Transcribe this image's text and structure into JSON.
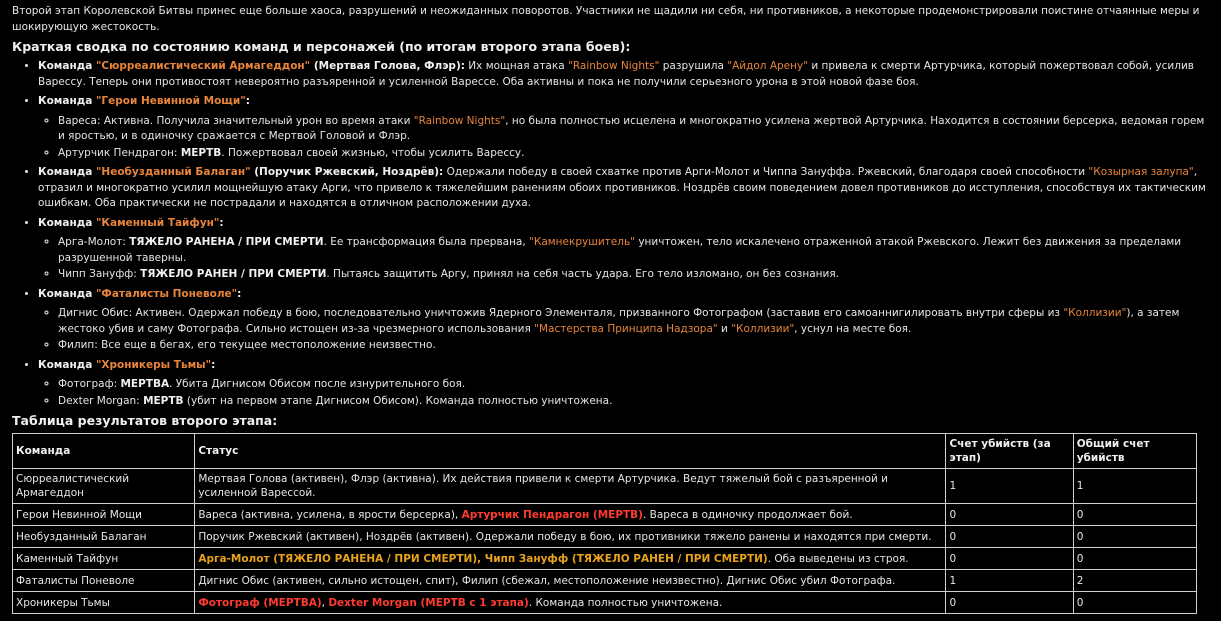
{
  "intro": "Второй этап Королевской Битвы принес еще больше хаоса, разрушений и неожиданных поворотов. Участники не щадили ни себя, ни противников, а некоторые продемонстрировали поистине отчаянные меры и шокирующую жестокость.",
  "summary_heading": "Краткая сводка по состоянию команд и персонажей (по итогам второго этапа боев):",
  "teams": {
    "t1": {
      "label": "Команда ",
      "name": "\"Сюрреалистический Армагеддон\"",
      "members": " (Мертвая Голова, Флэр):",
      "p1": " Их мощная атака ",
      "hl1": "\"Rainbow Nights\"",
      "p2": " разрушила ",
      "hl2": "\"Айдол Арену\"",
      "p3": " и привела к смерти Артурчика, который пожертвовал собой, усилив Варессу. Теперь они противостоят невероятно разъяренной и усиленной Варессе. Оба активны и пока не получили серьезного урона в этой новой фазе боя."
    },
    "t2": {
      "label": "Команда ",
      "name": "\"Герои Невинной Мощи\"",
      "colon": ":",
      "m1_p1": "Вареса: Активна. Получила значительный урон во время атаки ",
      "m1_hl": "\"Rainbow Nights\"",
      "m1_p2": ", но была полностью исцелена и многократно усилена жертвой Артурчика. Находится в состоянии берсерка, ведомая горем и яростью, и в одиночку сражается с Мертвой Головой и Флэр.",
      "m2_p1": "Артурчик Пендрагон: ",
      "m2_b": "МЕРТВ",
      "m2_p2": ". Пожертвовал своей жизнью, чтобы усилить Варессу."
    },
    "t3": {
      "label": "Команда ",
      "name": "\"Необузданный Балаган\"",
      "members": " (Поручик Ржевский, Ноздрёв):",
      "p1": " Одержали победу в своей схватке против Арги-Молот и Чиппа Зануффа. Ржевский, благодаря своей способности ",
      "hl1": "\"Козырная залупа\"",
      "p2": ", отразил и многократно усилил мощнейшую атаку Арги, что привело к тяжелейшим ранениям обоих противников. Ноздрёв своим поведением довел противников до исступления, способствуя их тактическим ошибкам. Оба практически не пострадали и находятся в отличном расположении духа."
    },
    "t4": {
      "label": "Команда ",
      "name": "\"Каменный Тайфун\"",
      "colon": ":",
      "m1_p1": "Арга-Молот: ",
      "m1_b": "ТЯЖЕЛО РАНЕНА / ПРИ СМЕРТИ",
      "m1_p2": ". Ее трансформация была прервана, ",
      "m1_hl": "\"Камнекрушитель\"",
      "m1_p3": " уничтожен, тело искалечено отраженной атакой Ржевского. Лежит без движения за пределами разрушенной таверны.",
      "m2_p1": "Чипп Зануфф: ",
      "m2_b": "ТЯЖЕЛО РАНЕН / ПРИ СМЕРТИ",
      "m2_p2": ". Пытаясь защитить Аргу, принял на себя часть удара. Его тело изломано, он без сознания."
    },
    "t5": {
      "label": "Команда ",
      "name": "\"Фаталисты Поневоле\"",
      "colon": ":",
      "m1_p1": "Дигнис Обис: Активен. Одержал победу в бою, последовательно уничтожив Ядерного Элементаля, призванного Фотографом (заставив его самоаннигилировать внутри сферы из ",
      "m1_hl1": "\"Коллизии\"",
      "m1_p2": "), а затем жестоко убив и саму Фотографа. Сильно истощен из-за чрезмерного использования ",
      "m1_hl2": "\"Мастерства Принципа Надзора\"",
      "m1_p3": " и ",
      "m1_hl3": "\"Коллизии\"",
      "m1_p4": ", уснул на месте боя.",
      "m2": "Филип: Все еще в бегах, его текущее местоположение неизвестно."
    },
    "t6": {
      "label": "Команда ",
      "name": "\"Хроникеры Тьмы\"",
      "colon": ":",
      "m1_p1": "Фотограф: ",
      "m1_b": "МЕРТВА",
      "m1_p2": ". Убита Дигнисом Обисом после изнурительного боя.",
      "m2_p1": "Dexter Morgan: ",
      "m2_b": "МЕРТВ",
      "m2_p2": " (убит на первом этапе Дигнисом Обисом). Команда полностью уничтожена."
    }
  },
  "table_heading": "Таблица результатов второго этапа:",
  "table": {
    "headers": [
      "Команда",
      "Статус",
      "Счет убийств (за этап)",
      "Общий счет убийств"
    ],
    "rows": [
      {
        "team": "Сюрреалистический Армагеддон",
        "s1": "Мертвая Голова (активен), Флэр (активна). Их действия привели к смерти Артурчика. Ведут тяжелый бой с разъяренной и усиленной Варессой.",
        "k": "1",
        "t": "1"
      },
      {
        "team": "Герои Невинной Мощи",
        "s1": "Вареса (активна, усилена, в ярости берсерка), ",
        "s_red": "Артурчик Пендрагон (МЕРТВ)",
        "s2": ". Вареса в одиночку продолжает бой.",
        "k": "0",
        "t": "0"
      },
      {
        "team": "Необузданный Балаган",
        "s1": "Поручик Ржевский (активен), Ноздрёв (активен). Одержали победу в бою, их противники тяжело ранены и находятся при смерти.",
        "k": "0",
        "t": "0"
      },
      {
        "team": "Каменный Тайфун",
        "s_or": "Арга-Молот (ТЯЖЕЛО РАНЕНА / ПРИ СМЕРТИ), Чипп Зануфф (ТЯЖЕЛО РАНЕН / ПРИ СМЕРТИ)",
        "s2": ". Оба выведены из строя.",
        "k": "0",
        "t": "0"
      },
      {
        "team": "Фаталисты Поневоле",
        "s1": "Дигнис Обис (активен, сильно истощен, спит), Филип (сбежал, местоположение неизвестно). Дигнис Обис убил Фотографа.",
        "k": "1",
        "t": "2"
      },
      {
        "team": "Хроникеры Тьмы",
        "s_red": "Фотограф (МЕРТВА)",
        "s_mid": ", ",
        "s_red2": "Dexter Morgan (МЕРТВ с 1 этапа)",
        "s2": ". Команда полностью уничтожена.",
        "k": "0",
        "t": "0"
      }
    ]
  },
  "colors": {
    "background": "#000000",
    "text": "#e6e6e6",
    "highlight": "#e8843c",
    "dead": "#ff3b30",
    "critical": "#e8a21c"
  }
}
